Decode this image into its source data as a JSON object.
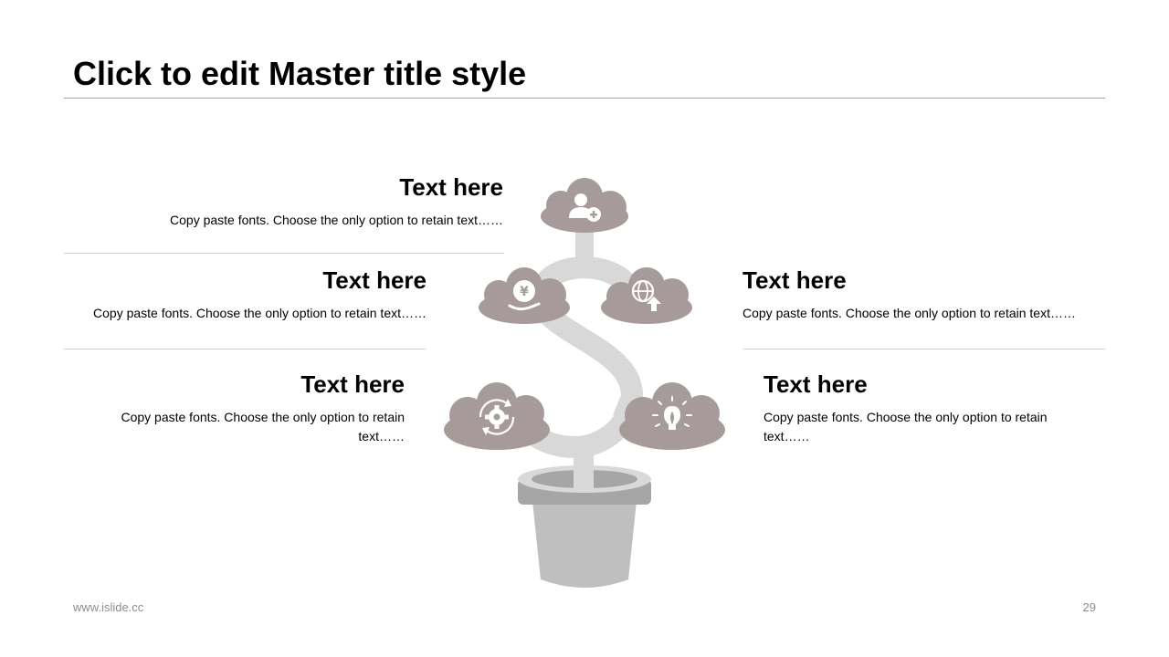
{
  "slide": {
    "title": "Click to edit Master title style",
    "footer_left": "www.islide.cc",
    "page_number": "29"
  },
  "items": [
    {
      "heading": "Text here",
      "body": "Copy paste fonts. Choose the only option to retain text……"
    },
    {
      "heading": "Text here",
      "body": "Copy paste fonts. Choose the only option to retain text……"
    },
    {
      "heading": "Text here",
      "body": "Copy paste fonts. Choose the only option to retain text……"
    },
    {
      "heading": "Text here",
      "body": "Copy paste fonts. Choose the only option to retain text……"
    },
    {
      "heading": "Text here",
      "body": "Copy paste fonts. Choose the only option to retain text……"
    }
  ],
  "illustration": {
    "cloud_color": "#a79a9a",
    "stem_color": "#d9d9d9",
    "pot_color": "#bfbfbf",
    "icons": [
      "user-add-icon",
      "yen-hand-icon",
      "globe-upload-icon",
      "gear-cycle-icon",
      "lightbulb-icon"
    ]
  }
}
